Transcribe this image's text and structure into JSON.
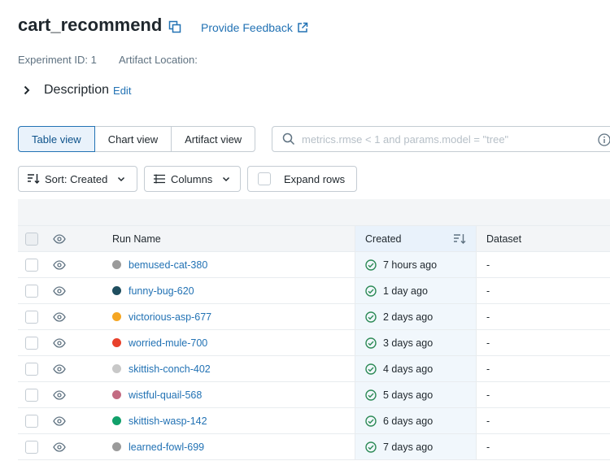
{
  "header": {
    "title": "cart_recommend",
    "feedback_label": "Provide Feedback"
  },
  "meta": {
    "experiment_id": "Experiment ID: 1",
    "artifact_location": "Artifact Location:"
  },
  "description": {
    "label": "Description",
    "edit_label": "Edit"
  },
  "view_tabs": [
    {
      "label": "Table view",
      "active": true
    },
    {
      "label": "Chart view",
      "active": false
    },
    {
      "label": "Artifact view",
      "active": false
    }
  ],
  "search": {
    "placeholder": "metrics.rmse < 1 and params.model = \"tree\""
  },
  "controls": {
    "sort_label": "Sort: Created",
    "columns_label": "Columns",
    "expand_label": "Expand rows"
  },
  "table": {
    "columns": {
      "run_name": "Run Name",
      "created": "Created",
      "dataset": "Dataset"
    },
    "rows": [
      {
        "name": "bemused-cat-380",
        "color": "#9a9a9a",
        "created": "7 hours ago",
        "dataset": "-"
      },
      {
        "name": "funny-bug-620",
        "color": "#1f4e5f",
        "created": "1 day ago",
        "dataset": "-"
      },
      {
        "name": "victorious-asp-677",
        "color": "#f5a623",
        "created": "2 days ago",
        "dataset": "-"
      },
      {
        "name": "worried-mule-700",
        "color": "#e8412c",
        "created": "3 days ago",
        "dataset": "-"
      },
      {
        "name": "skittish-conch-402",
        "color": "#c8c8c8",
        "created": "4 days ago",
        "dataset": "-"
      },
      {
        "name": "wistful-quail-568",
        "color": "#c36b82",
        "created": "5 days ago",
        "dataset": "-"
      },
      {
        "name": "skittish-wasp-142",
        "color": "#11a06a",
        "created": "6 days ago",
        "dataset": "-"
      },
      {
        "name": "learned-fowl-699",
        "color": "#9a9a9a",
        "created": "7 days ago",
        "dataset": "-"
      }
    ]
  },
  "colors": {
    "accent": "#2272b4",
    "success": "#2e8b57"
  }
}
